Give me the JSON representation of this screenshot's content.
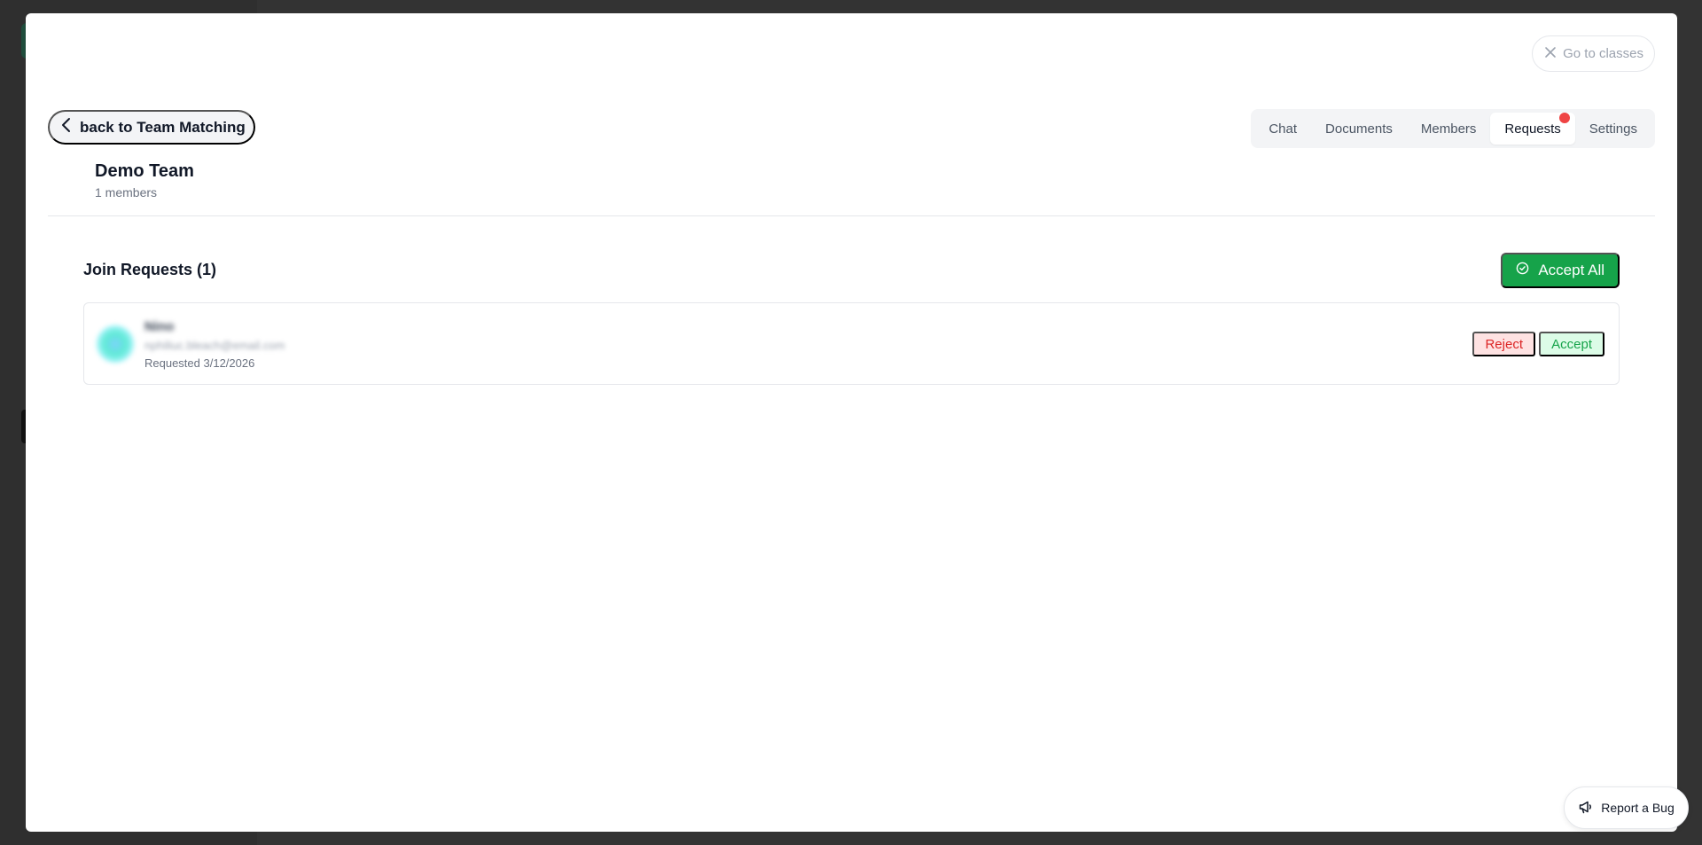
{
  "modal": {
    "close_label": "Go to classes"
  },
  "header": {
    "back_label": "back to Team Matching",
    "tabs": [
      {
        "label": "Chat"
      },
      {
        "label": "Documents"
      },
      {
        "label": "Members"
      },
      {
        "label": "Requests",
        "active": true,
        "notification": true
      },
      {
        "label": "Settings"
      }
    ]
  },
  "team": {
    "name": "Demo Team",
    "member_count": "1 members"
  },
  "requests": {
    "title": "Join Requests (1)",
    "accept_all_label": "Accept All",
    "items": [
      {
        "name": "Nino",
        "email": "nphiliuc.bleach@email.com",
        "requested": "Requested 3/12/2026",
        "reject_label": "Reject",
        "accept_label": "Accept"
      }
    ]
  },
  "bug_report": {
    "label": "Report a Bug"
  },
  "colors": {
    "accent_green": "#16a34a",
    "reject_red": "#dc2626",
    "notification_dot": "#ef4444"
  }
}
